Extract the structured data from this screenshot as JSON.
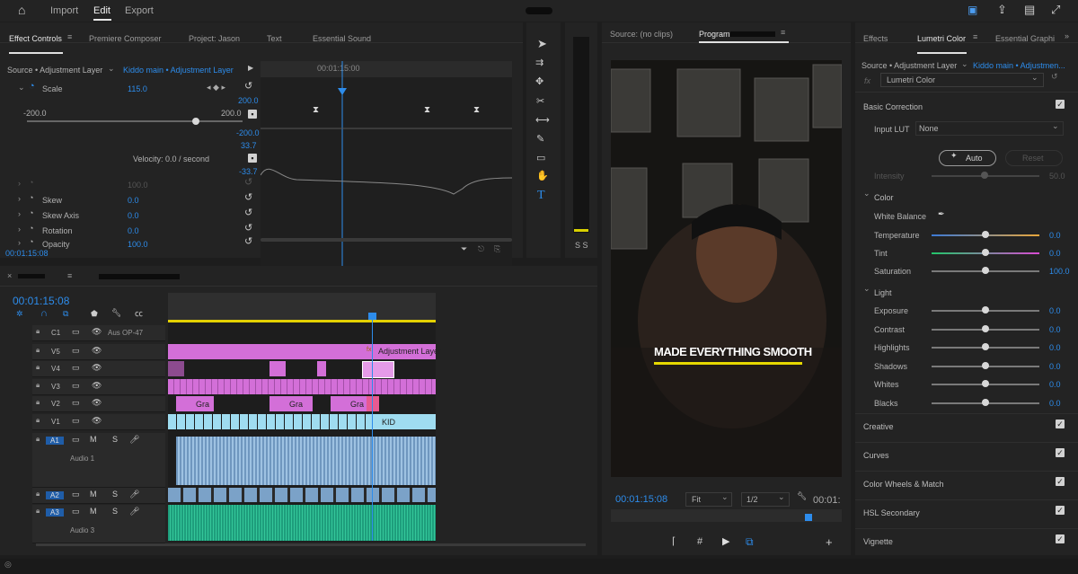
{
  "topbar": {
    "import": "Import",
    "edit": "Edit",
    "export": "Export"
  },
  "effect_controls": {
    "tabs": [
      "Effect Controls",
      "Premiere Composer",
      "Project: Jason",
      "Text",
      "Essential Sound"
    ],
    "source_label": "Source • Adjustment Layer",
    "clip_label": "Kiddo main • Adjustment Layer",
    "ruler_time": "00:01:15:00",
    "scale_label": "Scale",
    "scale_value": "115.0",
    "min_label": "-200.0",
    "max_label": "200.0",
    "graph_top": "200.0",
    "graph_mid": "-200.0",
    "vel_top": "33.7",
    "vel_bottom": "-33.7",
    "velocity": "Velocity: 0.0 / second",
    "uniform_value": "100.0",
    "skew_label": "Skew",
    "skew_value": "0.0",
    "skew_axis_label": "Skew Axis",
    "skew_axis_value": "0.0",
    "rotation_label": "Rotation",
    "rotation_value": "0.0",
    "opacity_label": "Opacity",
    "opacity_value": "100.0",
    "timecode": "00:01:15:08"
  },
  "timeline": {
    "timecode": "00:01:15:08",
    "tracks": [
      {
        "id": "C1",
        "name": "Aus OP-47"
      },
      {
        "id": "V5",
        "name": ""
      },
      {
        "id": "V4",
        "name": ""
      },
      {
        "id": "V3",
        "name": ""
      },
      {
        "id": "V2",
        "name": ""
      },
      {
        "id": "V1",
        "name": ""
      },
      {
        "id": "A1",
        "name": "Audio 1"
      },
      {
        "id": "A2",
        "name": ""
      },
      {
        "id": "A3",
        "name": "Audio 3"
      }
    ],
    "adjustment_layer": "Adjustment Layer",
    "gra1": "Gra",
    "gra2": "Gra",
    "gra3": "Gra",
    "kid": "KID",
    "fx": "fx",
    "m": "M",
    "s": "S",
    "o": "0."
  },
  "program": {
    "source_tab": "Source: (no clips)",
    "program_tab": "Program:",
    "caption": "MADE EVERYTHING SMOOTH",
    "timecode": "00:01:15:08",
    "fit": "Fit",
    "ratio": "1/2",
    "right_tc": "00:01:",
    "meter_label": "S S"
  },
  "lumetri": {
    "tabs": [
      "Effects",
      "Lumetri Color",
      "Essential Graphi"
    ],
    "source_label": "Source • Adjustment Layer",
    "clip_label": "Kiddo main • Adjustmen...",
    "fx_name": "Lumetri Color",
    "basic_correction": "Basic Correction",
    "input_lut_label": "Input LUT",
    "input_lut_value": "None",
    "auto": "Auto",
    "reset": "Reset",
    "intensity_label": "Intensity",
    "intensity_value": "50.0",
    "color_section": "Color",
    "white_balance": "White Balance",
    "color_rows": [
      {
        "label": "Temperature",
        "value": "0.0",
        "pos": 0.5
      },
      {
        "label": "Tint",
        "value": "0.0",
        "pos": 0.5
      },
      {
        "label": "Saturation",
        "value": "100.0",
        "pos": 0.5
      }
    ],
    "light_section": "Light",
    "light_rows": [
      {
        "label": "Exposure",
        "value": "0.0",
        "pos": 0.5
      },
      {
        "label": "Contrast",
        "value": "0.0",
        "pos": 0.5
      },
      {
        "label": "Highlights",
        "value": "0.0",
        "pos": 0.5
      },
      {
        "label": "Shadows",
        "value": "0.0",
        "pos": 0.5
      },
      {
        "label": "Whites",
        "value": "0.0",
        "pos": 0.5
      },
      {
        "label": "Blacks",
        "value": "0.0",
        "pos": 0.5
      }
    ],
    "sections": [
      "Creative",
      "Curves",
      "Color Wheels & Match",
      "HSL Secondary",
      "Vignette"
    ]
  }
}
